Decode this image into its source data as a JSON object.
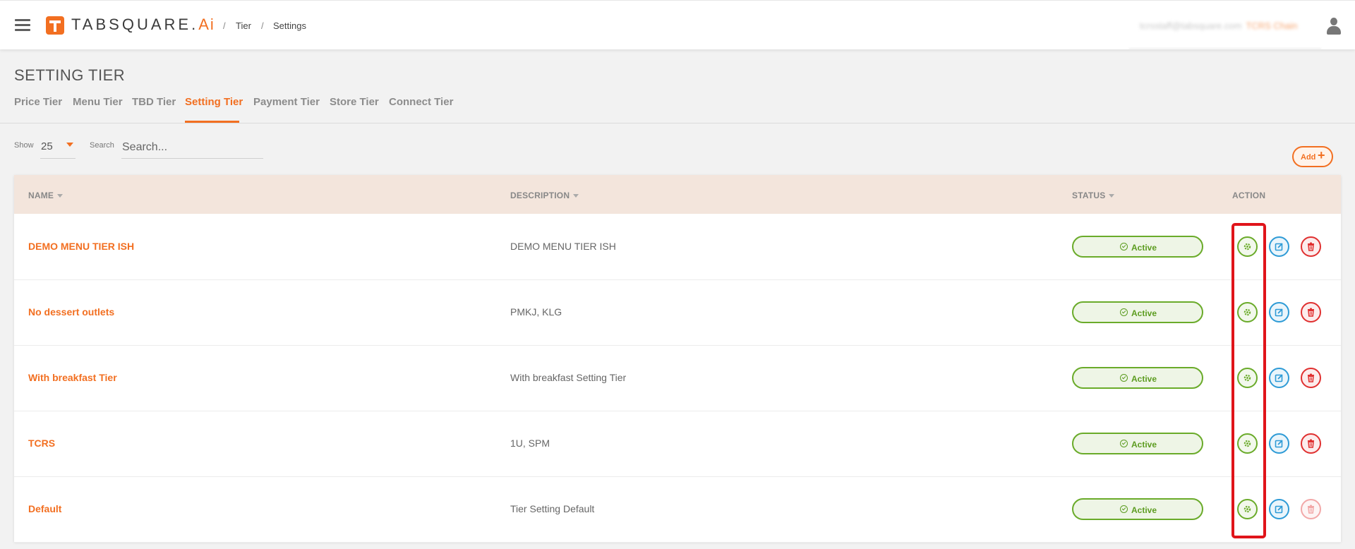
{
  "header": {
    "brand_main": "TABSQUARE.",
    "brand_ai": "Ai",
    "breadcrumb": [
      "Tier",
      "Settings"
    ],
    "breadcrumb_sep": "/",
    "user_email": "tcrsstaff@tabsquare.com",
    "user_name": "TCRS Chain"
  },
  "page": {
    "title": "SETTING TIER",
    "tabs": [
      {
        "label": "Price Tier",
        "active": false
      },
      {
        "label": "Menu Tier",
        "active": false
      },
      {
        "label": "TBD Tier",
        "active": false
      },
      {
        "label": "Setting Tier",
        "active": true
      },
      {
        "label": "Payment Tier",
        "active": false
      },
      {
        "label": "Store Tier",
        "active": false
      },
      {
        "label": "Connect Tier",
        "active": false
      }
    ]
  },
  "controls": {
    "show_label": "Show",
    "show_value": "25",
    "search_label": "Search",
    "search_placeholder": "Search...",
    "add_label": "Add",
    "add_icon": "+"
  },
  "table": {
    "columns": [
      "NAME",
      "DESCRIPTION",
      "STATUS",
      "ACTION"
    ],
    "rows": [
      {
        "name": "DEMO MENU TIER ISH",
        "description": "DEMO MENU TIER ISH",
        "status": "Active",
        "delete_enabled": true
      },
      {
        "name": "No dessert outlets",
        "description": "PMKJ, KLG",
        "status": "Active",
        "delete_enabled": true
      },
      {
        "name": "With breakfast Tier",
        "description": "With breakfast Setting Tier",
        "status": "Active",
        "delete_enabled": true
      },
      {
        "name": "TCRS",
        "description": "1U, SPM",
        "status": "Active",
        "delete_enabled": true
      },
      {
        "name": "Default",
        "description": "Tier Setting Default",
        "status": "Active",
        "delete_enabled": false
      }
    ]
  },
  "colors": {
    "accent": "#f26f21",
    "status_green": "#6aab2a",
    "edit_blue": "#2e9bd6",
    "delete_red": "#e03030",
    "highlight_red": "#e0141a"
  },
  "icons": [
    "menu-icon",
    "user-icon",
    "caret-down-icon",
    "plus-icon",
    "check-circle-icon",
    "gear-icon",
    "edit-icon",
    "trash-icon"
  ]
}
